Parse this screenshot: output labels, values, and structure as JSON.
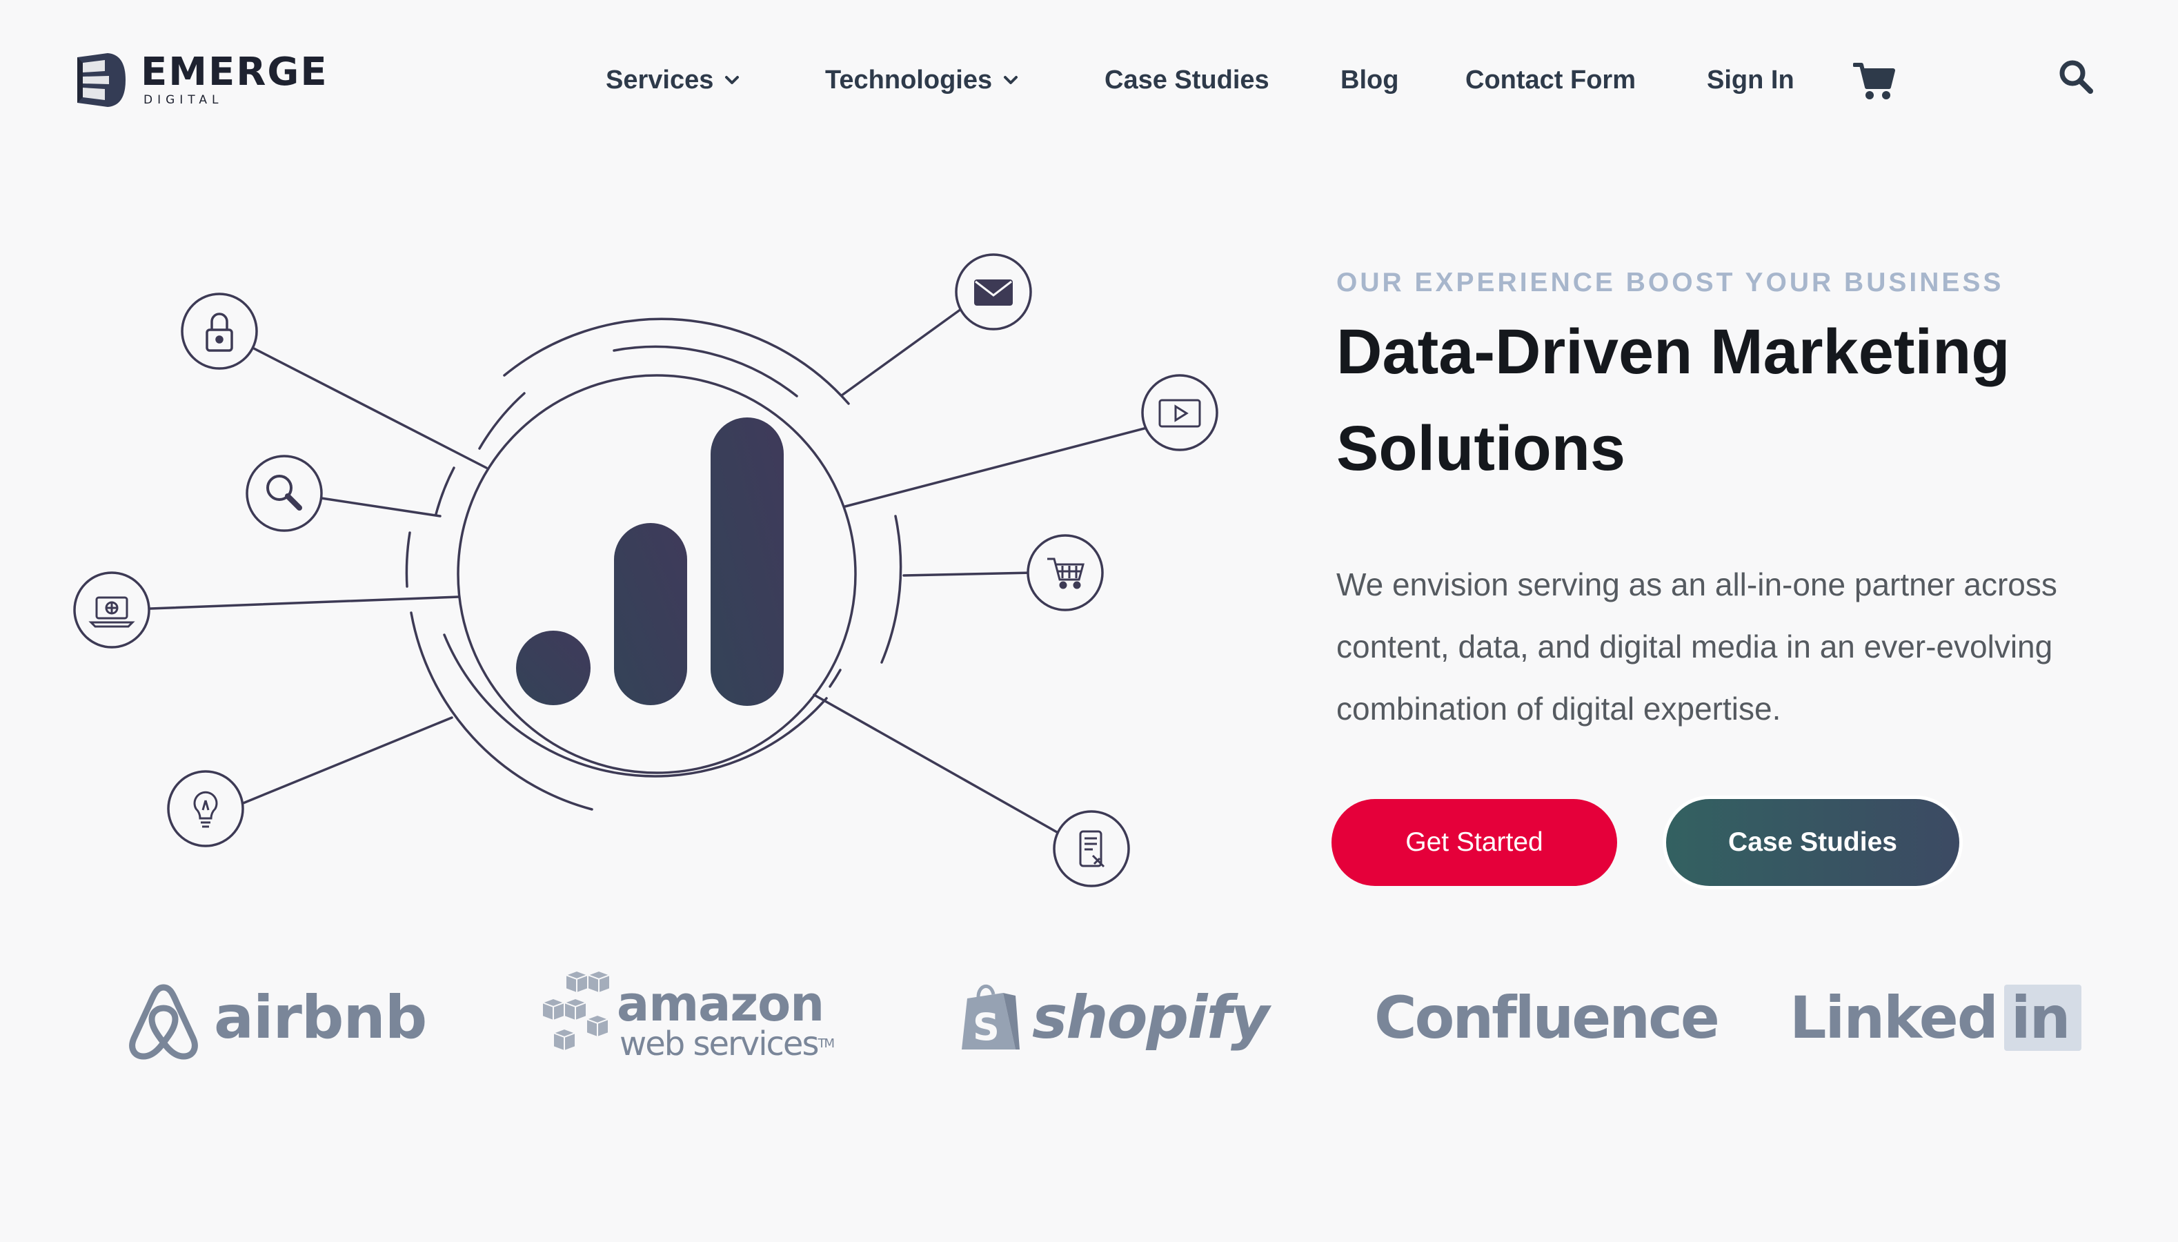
{
  "brand": {
    "name": "EMERGE",
    "sub": "DIGITAL"
  },
  "nav": {
    "items": [
      {
        "label": "Services"
      },
      {
        "label": "Technologies"
      },
      {
        "label": "Case Studies"
      },
      {
        "label": "Blog"
      },
      {
        "label": "Contact Form"
      },
      {
        "label": "Sign In"
      }
    ]
  },
  "icons": {
    "cart": "cart-icon",
    "search": "search-icon",
    "illustration_nodes": [
      "lock-icon",
      "magnifier-icon",
      "laptop-icon",
      "lightbulb-icon",
      "envelope-icon",
      "video-icon",
      "cart-icon",
      "mobile-icon"
    ]
  },
  "hero": {
    "eyebrow": "OUR EXPERIENCE BOOST YOUR BUSINESS",
    "headline": "Data-Driven Marketing Solutions",
    "description": "We envision serving as an all-in-one partner across content, data, and digital media in an ever-evolving combination of digital expertise.",
    "primary_button": "Get Started",
    "secondary_button": "Case Studies"
  },
  "logos": {
    "airbnb": "airbnb",
    "aws_main": "amazon",
    "aws_sub": "web services",
    "aws_tm": "TM",
    "shopify": "shopify",
    "confluence": "Confluence",
    "linkedin_a": "Linked",
    "linkedin_b": "in"
  },
  "colors": {
    "background": "#f8f8f9",
    "nav_text": "#2e3a4a",
    "eyebrow": "#a7b6cc",
    "primary": "#e5003a",
    "secondary_start": "#336161",
    "secondary_end": "#3c4a63",
    "illustration": "#3d3a55",
    "logo_gray": "#7a8699"
  }
}
